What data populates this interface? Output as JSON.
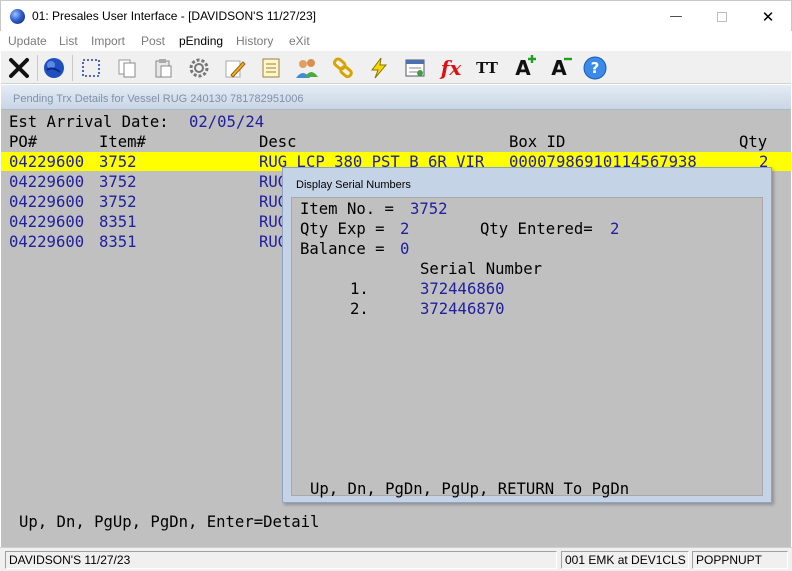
{
  "window": {
    "title": "01: Presales User Interface - [DAVIDSON'S 11/27/23]",
    "minimize_glyph": "—",
    "close_glyph": "✕"
  },
  "menu": {
    "items": [
      {
        "label": "Update",
        "active": false
      },
      {
        "label": "List",
        "active": false
      },
      {
        "label": "Import",
        "active": false
      },
      {
        "label": "Post",
        "active": false
      },
      {
        "label": "pEnding",
        "active": true
      },
      {
        "label": "History",
        "active": false
      },
      {
        "label": "eXit",
        "active": false
      }
    ]
  },
  "toolbar": {
    "icons": [
      "close-x-icon",
      "globe-icon",
      "selection-box-icon",
      "copy-icon",
      "paste-icon",
      "settings-gear-icon",
      "edit-pencil-icon",
      "notepad-icon",
      "users-icon",
      "chain-link-icon",
      "lightning-icon",
      "calendar-window-icon",
      "function-fx-icon",
      "text-size-icon",
      "font-increase-icon",
      "font-decrease-icon",
      "help-icon"
    ],
    "fx_label": "fx",
    "tt_label": "TT",
    "help_label": "?",
    "font_up_label": "A",
    "font_down_label": "A"
  },
  "panel": {
    "heading": "Pending Trx Details for Vessel  RUG 240130 781782951006",
    "arrival_label": "Est Arrival Date:",
    "arrival_value": "02/05/24",
    "columns": {
      "po": "PO#",
      "item": "Item#",
      "desc": "Desc",
      "box_id": "Box ID",
      "qty": "Qty"
    },
    "rows": [
      {
        "po": "04229600",
        "item": "3752",
        "desc": "RUG LCP 380 PST B 6R VIR",
        "box_id": "00007986910114567938",
        "qty": "2",
        "selected": true
      },
      {
        "po": "04229600",
        "item": "3752",
        "desc": "RUG",
        "box_id": "",
        "qty": "",
        "selected": false
      },
      {
        "po": "04229600",
        "item": "3752",
        "desc": "RUG",
        "box_id": "",
        "qty": "",
        "selected": false
      },
      {
        "po": "04229600",
        "item": "8351",
        "desc": "RUG",
        "box_id": "",
        "qty": "",
        "selected": false
      },
      {
        "po": "04229600",
        "item": "8351",
        "desc": "RUG",
        "box_id": "",
        "qty": "",
        "selected": false
      }
    ],
    "footer": "Up, Dn, PgUp, PgDn, Enter=Detail"
  },
  "dialog": {
    "title": "Display Serial Numbers",
    "item_label": "Item No. =",
    "item_value": "3752",
    "qty_exp_label": "Qty Exp =",
    "qty_exp_value": "2",
    "qty_entered_label": "Qty Entered=",
    "qty_entered_value": "2",
    "balance_label": "Balance =",
    "balance_value": "0",
    "serial_header": "Serial Number",
    "serials": [
      {
        "index": "1.",
        "value": "372446860"
      },
      {
        "index": "2.",
        "value": "372446870"
      }
    ],
    "footer": "Up, Dn, PgDn, PgUp, RETURN To PgDn"
  },
  "statusbar": {
    "company": "DAVIDSON'S 11/27/23",
    "session": "001 EMK at DEV1CLS",
    "program": "POPPNUPT"
  },
  "colors": {
    "terminal_bg": "#c0c0c0",
    "highlight": "#ffff00",
    "value_blue": "#2020a0"
  }
}
